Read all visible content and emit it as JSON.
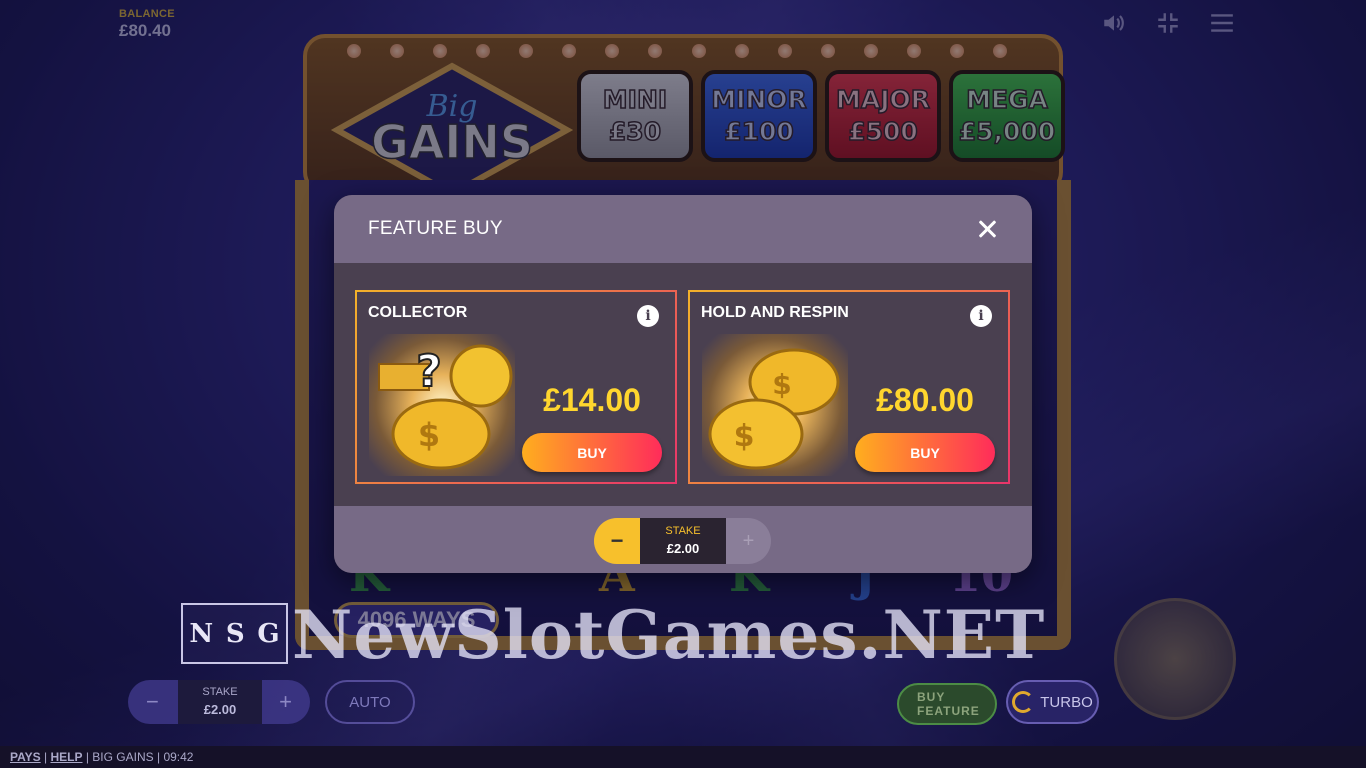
{
  "header": {
    "balance_label": "BALANCE",
    "balance_value": "£80.40",
    "icons": [
      "speaker-icon",
      "collapse-icon",
      "menu-icon"
    ]
  },
  "game": {
    "logo_line1": "Big",
    "logo_line2": "GAINS",
    "jackpots": [
      {
        "name": "MINI",
        "value": "£30",
        "color": "#b5b5b5"
      },
      {
        "name": "MINOR",
        "value": "£100",
        "color": "#2f58d0"
      },
      {
        "name": "MAJOR",
        "value": "£500",
        "color": "#d42833"
      },
      {
        "name": "MEGA",
        "value": "£5,000",
        "color": "#33a83a"
      }
    ],
    "ways_label": "4096 WAYS",
    "reel_symbols": [
      "K",
      "A",
      "K",
      "J",
      "10"
    ]
  },
  "modal": {
    "title": "FEATURE BUY",
    "options": [
      {
        "title": "COLLECTOR",
        "price": "£14.00",
        "buy_label": "BUY",
        "art": "gold-bars-coin-piggy-icon"
      },
      {
        "title": "HOLD AND RESPIN",
        "price": "£80.00",
        "buy_label": "BUY",
        "art": "two-gold-piggies-icon"
      }
    ],
    "stake": {
      "label": "STAKE",
      "value": "£2.00",
      "minus": "−",
      "plus": "+"
    }
  },
  "controls": {
    "stake_label": "STAKE",
    "stake_value": "£2.00",
    "minus": "−",
    "plus": "+",
    "auto_label": "AUTO",
    "buy_feature_line1": "BUY",
    "buy_feature_line2": "FEATURE",
    "turbo_label": "TURBO"
  },
  "watermark": {
    "logo_letters": [
      "N",
      "S",
      "G"
    ],
    "text": "NewSlotGames.NET"
  },
  "footer": {
    "pays": "PAYS",
    "help": "HELP",
    "game_name": "BIG GAINS",
    "time": "09:42"
  },
  "colors": {
    "accent_yellow": "#ffd62e",
    "buy_gradient_start": "#ffae1e",
    "buy_gradient_end": "#ff2c5a",
    "modal_header": "#776a86",
    "modal_body": "#4a4050"
  }
}
